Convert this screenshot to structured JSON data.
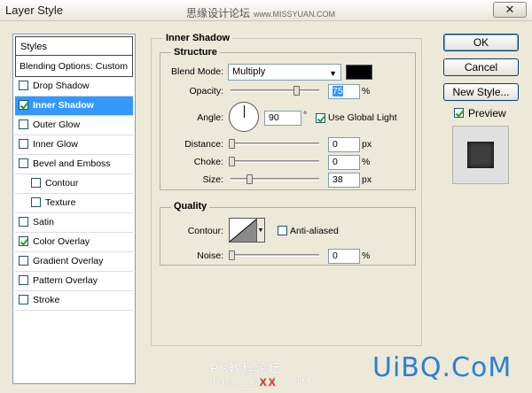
{
  "window": {
    "title": "Layer Style",
    "close_glyph": "✕",
    "watermark_top": "思缘设计论坛",
    "watermark_url": "www.MISSYUAN.COM"
  },
  "styles_list": {
    "header": "Styles",
    "blending_options": "Blending Options: Custom",
    "items": [
      {
        "label": "Drop Shadow",
        "checked": false,
        "selected": false,
        "sub": false
      },
      {
        "label": "Inner Shadow",
        "checked": true,
        "selected": true,
        "sub": false
      },
      {
        "label": "Outer Glow",
        "checked": false,
        "selected": false,
        "sub": false
      },
      {
        "label": "Inner Glow",
        "checked": false,
        "selected": false,
        "sub": false
      },
      {
        "label": "Bevel and Emboss",
        "checked": false,
        "selected": false,
        "sub": false
      },
      {
        "label": "Contour",
        "checked": false,
        "selected": false,
        "sub": true
      },
      {
        "label": "Texture",
        "checked": false,
        "selected": false,
        "sub": true
      },
      {
        "label": "Satin",
        "checked": false,
        "selected": false,
        "sub": false
      },
      {
        "label": "Color Overlay",
        "checked": true,
        "selected": false,
        "sub": false
      },
      {
        "label": "Gradient Overlay",
        "checked": false,
        "selected": false,
        "sub": false
      },
      {
        "label": "Pattern Overlay",
        "checked": false,
        "selected": false,
        "sub": false
      },
      {
        "label": "Stroke",
        "checked": false,
        "selected": false,
        "sub": false
      }
    ]
  },
  "inner_shadow": {
    "section_title": "Inner Shadow",
    "structure": {
      "title": "Structure",
      "blend_mode_label": "Blend Mode:",
      "blend_mode_value": "Multiply",
      "shadow_color": "#000000",
      "opacity_label": "Opacity:",
      "opacity_value": "75",
      "opacity_unit": "%",
      "opacity_level": 0.75,
      "angle_label": "Angle:",
      "angle_value": "90",
      "angle_unit": "°",
      "use_global_light_label": "Use Global Light",
      "use_global_light": true,
      "distance_label": "Distance:",
      "distance_value": "0",
      "distance_unit": "px",
      "choke_label": "Choke:",
      "choke_value": "0",
      "choke_unit": "%",
      "size_label": "Size:",
      "size_value": "38",
      "size_unit": "px"
    },
    "quality": {
      "title": "Quality",
      "contour_label": "Contour:",
      "anti_aliased_label": "Anti-aliased",
      "anti_aliased": false,
      "noise_label": "Noise:",
      "noise_value": "0",
      "noise_unit": "%"
    }
  },
  "buttons": {
    "ok": "OK",
    "cancel": "Cancel",
    "new_style": "New Style...",
    "preview_label": "Preview",
    "preview_checked": true
  },
  "watermarks": {
    "ps_text": "PS教程论坛",
    "bbs_prefix": "BBS.16",
    "bbs_xx": "XX",
    "bbs_suffix": ".COM",
    "uibq": "UiBQ.CoM"
  },
  "colors": {
    "selection": "#3399ff",
    "dialog_bg": "#ece9d8",
    "uibq_blue": "#2a7fd6"
  }
}
